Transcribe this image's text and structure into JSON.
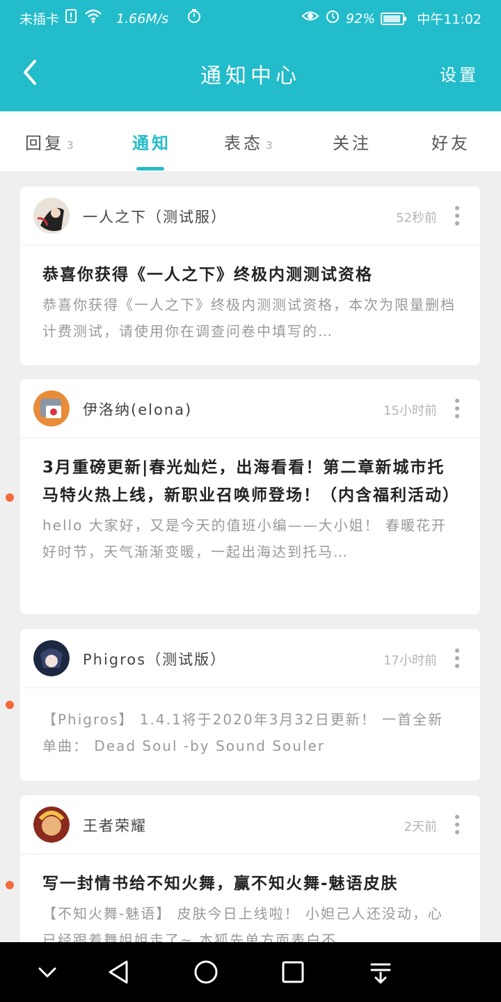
{
  "status_bar": {
    "carrier": "未插卡",
    "speed": "1.66M/s",
    "battery": "92%",
    "time": "中午11:02",
    "battery_level": 0.92,
    "icons": [
      "sim-alert-icon",
      "wifi-icon",
      "timer-icon",
      "eye-icon",
      "alarm-icon",
      "battery-icon"
    ]
  },
  "navbar": {
    "title": "通知中心",
    "settings_label": "设置",
    "back_icon": "chevron-left-icon"
  },
  "tabs": [
    {
      "label": "回复",
      "count": "3"
    },
    {
      "label": "通知",
      "count": ""
    },
    {
      "label": "表态",
      "count": "3"
    },
    {
      "label": "关注",
      "count": ""
    },
    {
      "label": "好友",
      "count": ""
    }
  ],
  "active_tab": "通知",
  "colors": {
    "accent": "#22bccb",
    "unread": "#f2693a"
  },
  "notifications": [
    {
      "source": "一人之下（测试服）",
      "time": "52秒前",
      "title": "恭喜你获得《一人之下》终极内测测试资格",
      "desc": "恭喜你获得《一人之下》终极内测测试资格，本次为限量删档计费测试，请使用你在调查问卷中填写的…",
      "unread": false
    },
    {
      "source": "伊洛纳(elona)",
      "time": "15小时前",
      "title": "3月重磅更新|春光灿烂，出海看看！第二章新城市托马特火热上线，新职业召唤师登场！（内含福利活动）",
      "desc": "hello 大家好，又是今天的值班小编——大小姐！ 春暖花开好时节，天气渐渐变暖，一起出海达到托马…",
      "unread": true
    },
    {
      "source": "Phigros（测试版）",
      "time": "17小时前",
      "title": "",
      "desc": "【Phigros】 1.4.1将于2020年3月32日更新！ 一首全新单曲： Dead Soul -by Sound Souler",
      "unread": true
    },
    {
      "source": "王者荣耀",
      "time": "2天前",
      "title": "写一封情书给不知火舞，赢不知火舞-魅语皮肤",
      "desc": "【不知火舞-魅语】 皮肤今日上线啦！ 小妲己人还没动，心已经跟着舞姐姐走了~ 本狐先单方面表白不…",
      "unread": true
    }
  ],
  "bottom_nav": [
    "chevron-down-icon",
    "back-triangle-icon",
    "home-circle-icon",
    "recents-square-icon",
    "notification-pull-icon"
  ]
}
